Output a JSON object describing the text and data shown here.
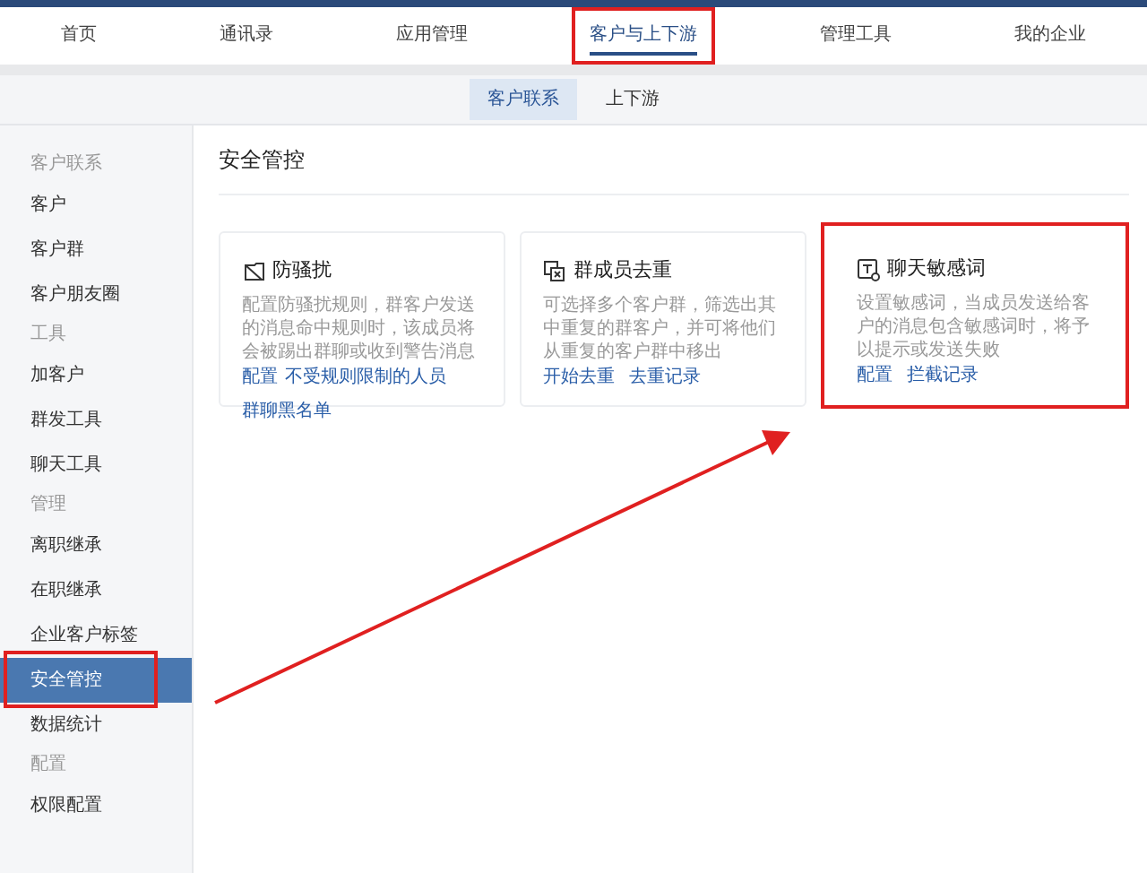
{
  "top_nav": [
    {
      "label": "首页",
      "selected": false,
      "highlighted": false
    },
    {
      "label": "通讯录",
      "selected": false,
      "highlighted": false
    },
    {
      "label": "应用管理",
      "selected": false,
      "highlighted": false
    },
    {
      "label": "客户与上下游",
      "selected": true,
      "highlighted": true
    },
    {
      "label": "管理工具",
      "selected": false,
      "highlighted": false
    },
    {
      "label": "我的企业",
      "selected": false,
      "highlighted": false
    }
  ],
  "sub_nav": [
    {
      "label": "客户联系",
      "selected": true
    },
    {
      "label": "上下游",
      "selected": false
    }
  ],
  "sidebar": {
    "groups": [
      {
        "heading": "客户联系",
        "items": [
          {
            "label": "客户",
            "selected": false,
            "highlighted": false
          },
          {
            "label": "客户群",
            "selected": false,
            "highlighted": false
          },
          {
            "label": "客户朋友圈",
            "selected": false,
            "highlighted": false
          }
        ]
      },
      {
        "heading": "工具",
        "items": [
          {
            "label": "加客户",
            "selected": false,
            "highlighted": false
          },
          {
            "label": "群发工具",
            "selected": false,
            "highlighted": false
          },
          {
            "label": "聊天工具",
            "selected": false,
            "highlighted": false
          }
        ]
      },
      {
        "heading": "管理",
        "items": [
          {
            "label": "离职继承",
            "selected": false,
            "highlighted": false
          },
          {
            "label": "在职继承",
            "selected": false,
            "highlighted": false
          },
          {
            "label": "企业客户标签",
            "selected": false,
            "highlighted": false
          },
          {
            "label": "安全管控",
            "selected": true,
            "highlighted": true
          },
          {
            "label": "数据统计",
            "selected": false,
            "highlighted": false
          }
        ]
      },
      {
        "heading": "配置",
        "items": [
          {
            "label": "权限配置",
            "selected": false,
            "highlighted": false
          }
        ]
      }
    ]
  },
  "page_title": "安全管控",
  "cards": [
    {
      "kind": "shield",
      "title": "防骚扰",
      "description": "配置防骚扰规则，群客户发送的消息命中规则时，该成员将会被踢出群聊或收到警告消息",
      "links": [
        "配置",
        "不受规则限制的人员",
        "群聊黑名单"
      ],
      "highlighted": false
    },
    {
      "kind": "dedupe",
      "title": "群成员去重",
      "description": "可选择多个客户群，筛选出其中重复的群客户，并可将他们从重复的客户群中移出",
      "links": [
        "开始去重",
        "去重记录"
      ],
      "highlighted": false
    },
    {
      "kind": "words",
      "title": "聊天敏感词",
      "description": "设置敏感词，当成员发送给客户的消息包含敏感词时，将予以提示或发送失败",
      "links": [
        "配置",
        "拦截记录"
      ],
      "highlighted": true
    }
  ],
  "annotation_arrow": true
}
